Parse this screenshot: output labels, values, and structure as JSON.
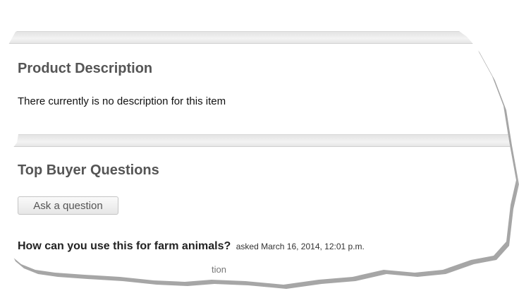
{
  "product_description": {
    "title": "Product Description",
    "text": "There currently is no description for this item"
  },
  "buyer_questions": {
    "title": "Top Buyer Questions",
    "ask_button_label": "Ask a question",
    "questions": [
      {
        "text": "How can you use this for farm animals?",
        "meta": "asked March 16, 2014, 12:01 p.m."
      }
    ],
    "partial_text": "tion"
  }
}
